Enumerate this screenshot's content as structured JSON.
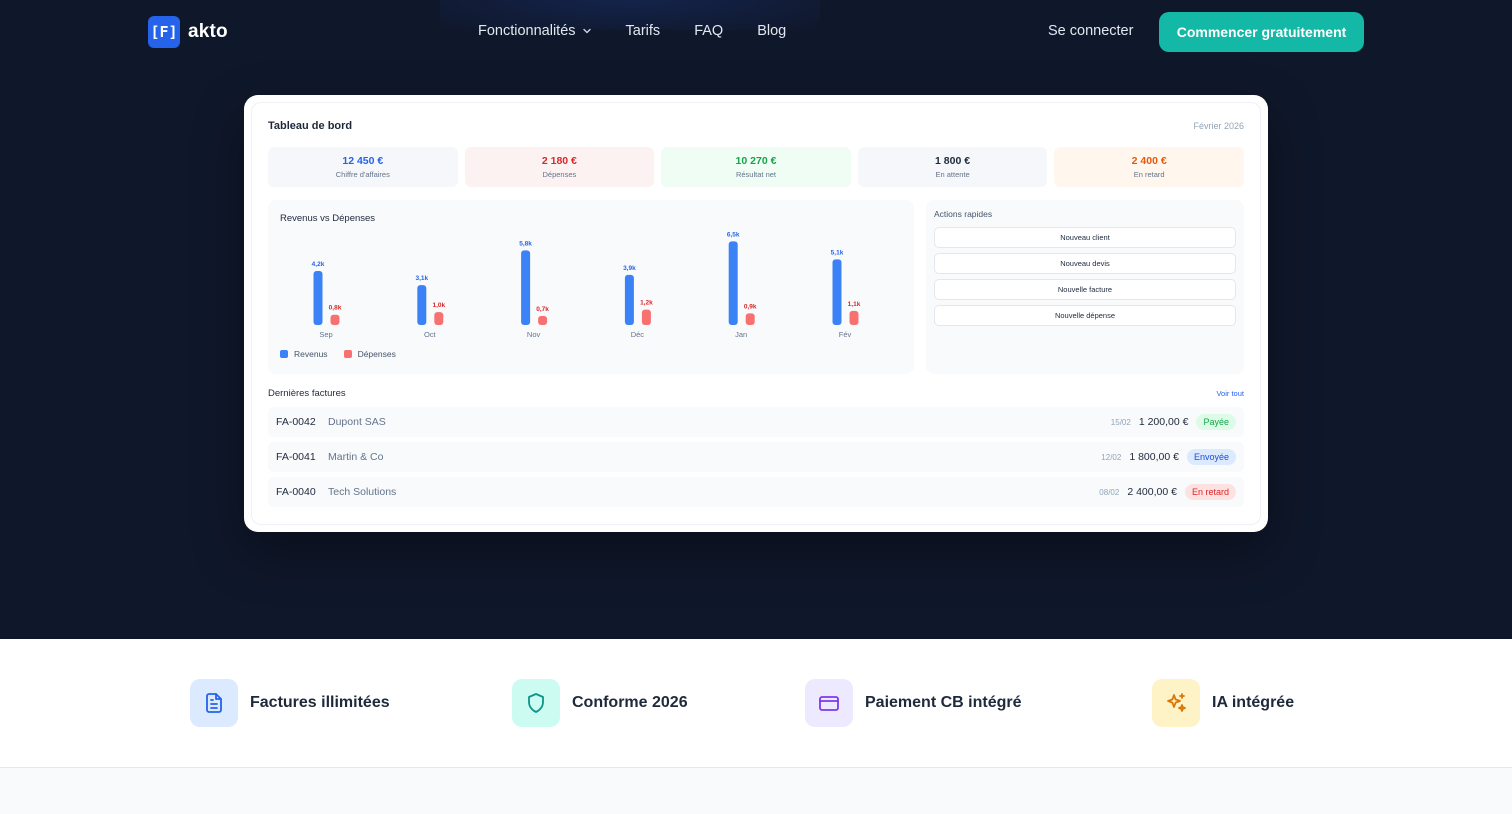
{
  "brand": {
    "logo_mark": "[F]",
    "name": "akto"
  },
  "nav": {
    "links": [
      {
        "label": "Fonctionnalités",
        "dropdown": true
      },
      {
        "label": "Tarifs"
      },
      {
        "label": "FAQ"
      },
      {
        "label": "Blog"
      }
    ],
    "login_label": "Se connecter",
    "cta_label": "Commencer gratuitement"
  },
  "dashboard": {
    "title": "Tableau de bord",
    "date": "Février 2026",
    "kpis": [
      {
        "value": "12 450 €",
        "label": "Chiffre d'affaires",
        "color": "#2563eb",
        "bg": "#f5f7fa"
      },
      {
        "value": "2 180 €",
        "label": "Dépenses",
        "color": "#dc2626",
        "bg": "#fdf2f2"
      },
      {
        "value": "10 270 €",
        "label": "Résultat net",
        "color": "#16a34a",
        "bg": "#f0fdf4"
      },
      {
        "value": "1 800 €",
        "label": "En attente",
        "color": "#1e293b",
        "bg": "#f5f7fa"
      },
      {
        "value": "2 400 €",
        "label": "En retard",
        "color": "#ea580c",
        "bg": "#fff7ed"
      }
    ],
    "actions": {
      "title": "Actions rapides",
      "buttons": [
        "Nouveau client",
        "Nouveau devis",
        "Nouvelle facture",
        "Nouvelle dépense"
      ]
    },
    "invoices": {
      "title": "Dernières factures",
      "see_all": "Voir tout",
      "rows": [
        {
          "number": "FA-0042",
          "client": "Dupont SAS",
          "date": "15/02",
          "amount": "1 200,00 €",
          "status": "Payée",
          "status_color": "#16a34a",
          "status_bg": "#dcfce7"
        },
        {
          "number": "FA-0041",
          "client": "Martin & Co",
          "date": "12/02",
          "amount": "1 800,00 €",
          "status": "Envoyée",
          "status_color": "#1d4ed8",
          "status_bg": "#dbeafe"
        },
        {
          "number": "FA-0040",
          "client": "Tech Solutions",
          "date": "08/02",
          "amount": "2 400,00 €",
          "status": "En retard",
          "status_color": "#dc2626",
          "status_bg": "#fee2e2"
        }
      ]
    }
  },
  "chart_data": {
    "type": "bar",
    "title": "Revenus vs Dépenses",
    "categories": [
      "Sep",
      "Oct",
      "Nov",
      "Déc",
      "Jan",
      "Fév"
    ],
    "series": [
      {
        "name": "Revenus",
        "values": [
          4.2,
          3.1,
          5.8,
          3.9,
          6.5,
          5.1
        ],
        "labels": [
          "4,2k",
          "3,1k",
          "5,8k",
          "3,9k",
          "6,5k",
          "5,1k"
        ],
        "color": "#3b82f6"
      },
      {
        "name": "Dépenses",
        "values": [
          0.8,
          1.0,
          0.7,
          1.2,
          0.9,
          1.1
        ],
        "labels": [
          "0,8k",
          "1,0k",
          "0,7k",
          "1,2k",
          "0,9k",
          "1,1k"
        ],
        "color": "#f87171"
      }
    ],
    "legend": "bottom-left",
    "grid": false
  },
  "features": [
    {
      "label": "Factures illimitées",
      "icon": "document-icon",
      "icon_color": "#2563eb",
      "icon_bg": "#dbeafe"
    },
    {
      "label": "Conforme 2026",
      "icon": "shield-icon",
      "icon_color": "#0d9488",
      "icon_bg": "#ccfbf1"
    },
    {
      "label": "Paiement CB intégré",
      "icon": "credit-card-icon",
      "icon_color": "#7c3aed",
      "icon_bg": "#ede9fe"
    },
    {
      "label": "IA intégrée",
      "icon": "sparkles-icon",
      "icon_color": "#d97706",
      "icon_bg": "#fef3c7"
    }
  ]
}
